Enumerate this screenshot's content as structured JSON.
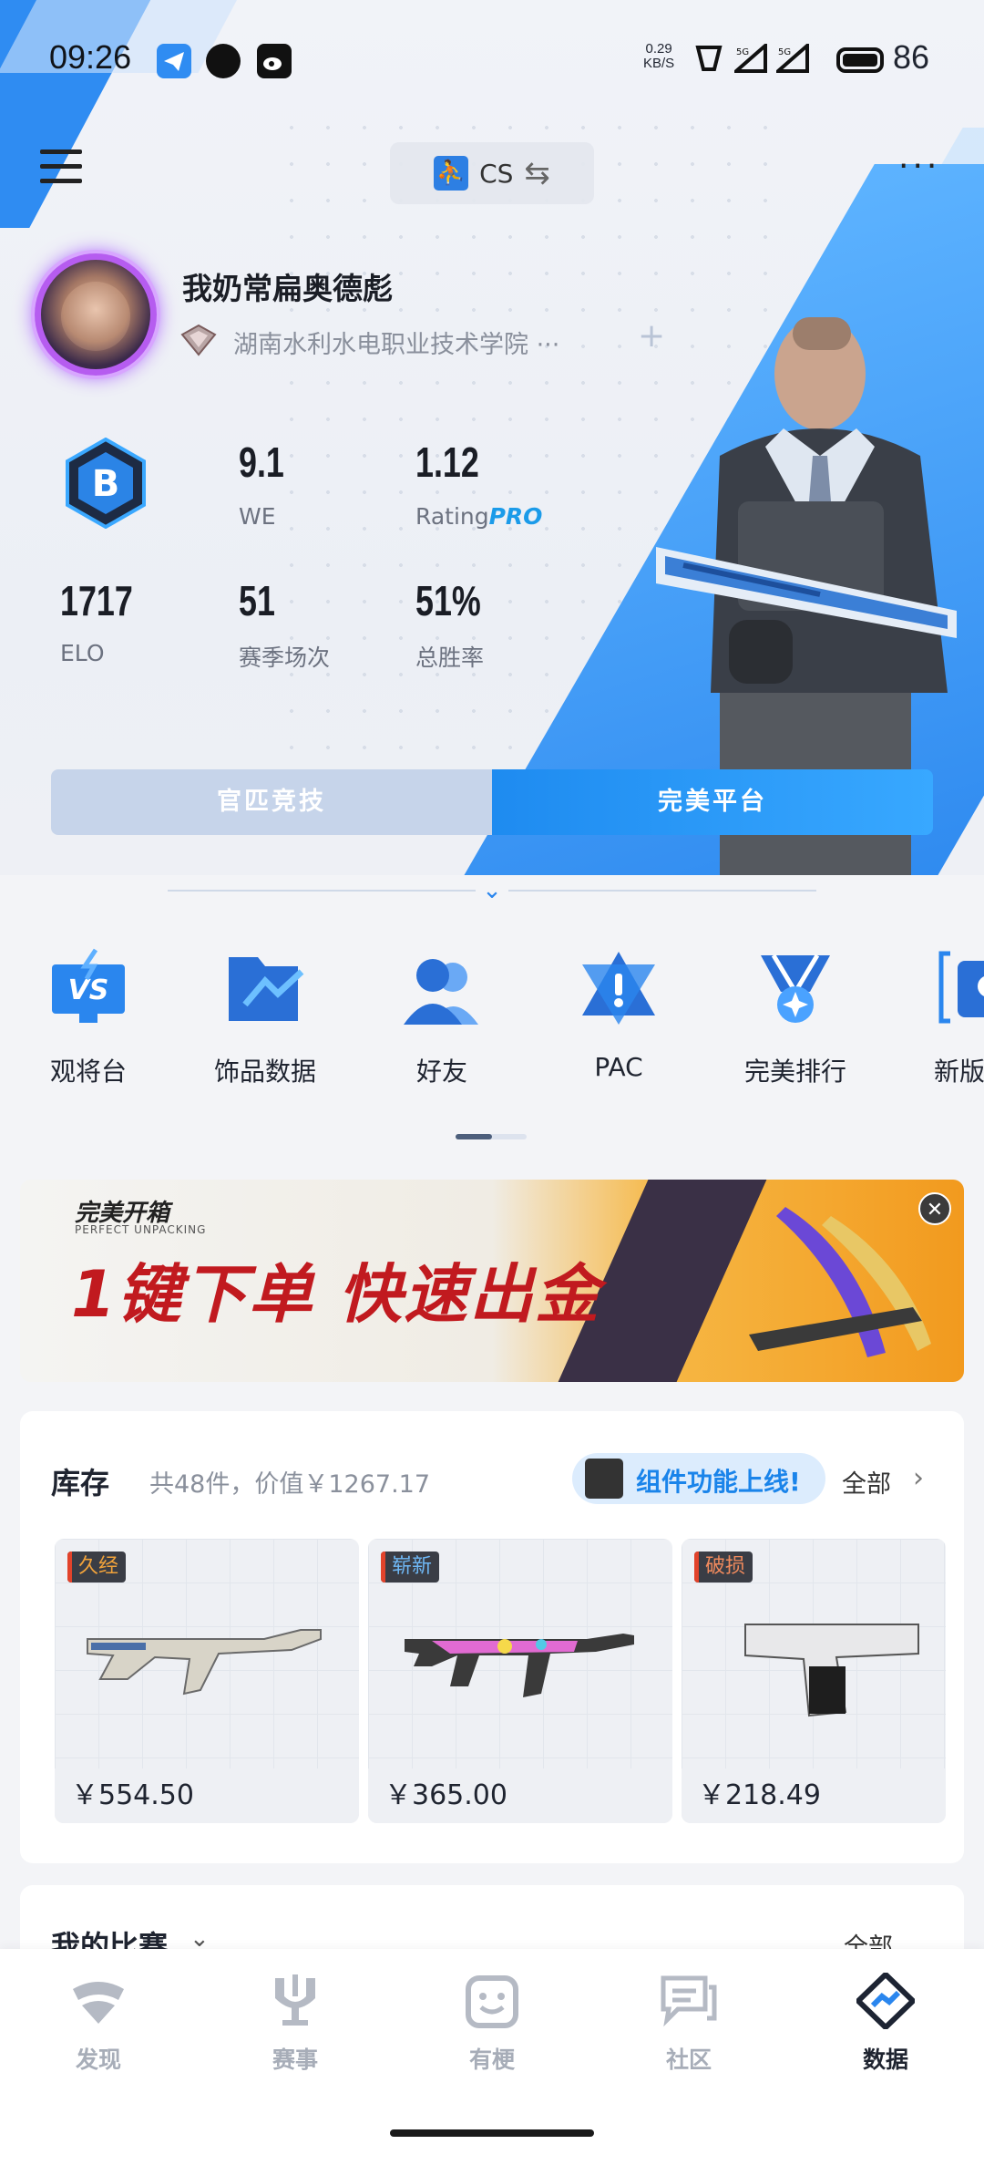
{
  "status": {
    "time": "09:26",
    "net_speed": "0.29",
    "net_unit": "KB/S",
    "battery": "86"
  },
  "header": {
    "game_name": "CS",
    "game_logo_char": "⛹"
  },
  "profile": {
    "nickname": "我奶常扁奥德彪",
    "school": "湖南水利水电职业技术学院 ···",
    "rank_letter": "B",
    "stats": [
      {
        "value": "9.1",
        "label": "WE"
      },
      {
        "value": "1.12",
        "label": "Rating",
        "label_suffix": "PRO"
      },
      {
        "value": "1717",
        "label": "ELO"
      },
      {
        "value": "51",
        "label": "赛季场次"
      },
      {
        "value": "51%",
        "label": "总胜率"
      }
    ]
  },
  "mode_tabs": [
    {
      "label": "官匹竞技",
      "active": false
    },
    {
      "label": "完美平台",
      "active": true
    }
  ],
  "shortcuts": [
    {
      "label": "观将台",
      "icon": "vs-monitor-icon"
    },
    {
      "label": "饰品数据",
      "icon": "folder-chart-icon"
    },
    {
      "label": "好友",
      "icon": "friends-icon"
    },
    {
      "label": "PAC",
      "icon": "pac-warning-icon"
    },
    {
      "label": "完美排行",
      "icon": "medal-icon"
    },
    {
      "label": "新版本",
      "icon": "new-version-icon"
    }
  ],
  "banner": {
    "brand": "完美开箱",
    "brand_sub": "PERFECT UNPACKING",
    "title": "1键下单 快速出金"
  },
  "inventory": {
    "title": "库存",
    "summary": "共48件，价值￥1267.17",
    "promo": "组件功能上线!",
    "all_label": "全部",
    "items": [
      {
        "tag": "久经",
        "tag_color": "#f0a23b",
        "price": "￥554.50"
      },
      {
        "tag": "崭新",
        "tag_color": "#6fb8f5",
        "price": "￥365.00"
      },
      {
        "tag": "破损",
        "tag_color": "#f08a5d",
        "price": "￥218.49"
      }
    ]
  },
  "matches": {
    "title": "我的比赛",
    "all_label": "全部"
  },
  "bottom_nav": [
    {
      "label": "发现",
      "icon": "discover-icon",
      "active": false
    },
    {
      "label": "赛事",
      "icon": "trophy-icon",
      "active": false
    },
    {
      "label": "有梗",
      "icon": "smile-icon",
      "active": false
    },
    {
      "label": "社区",
      "icon": "community-icon",
      "active": false
    },
    {
      "label": "数据",
      "icon": "data-icon",
      "active": true
    }
  ],
  "colors": {
    "accent": "#1e8bf0",
    "avatar_ring": "#b65cf0"
  }
}
